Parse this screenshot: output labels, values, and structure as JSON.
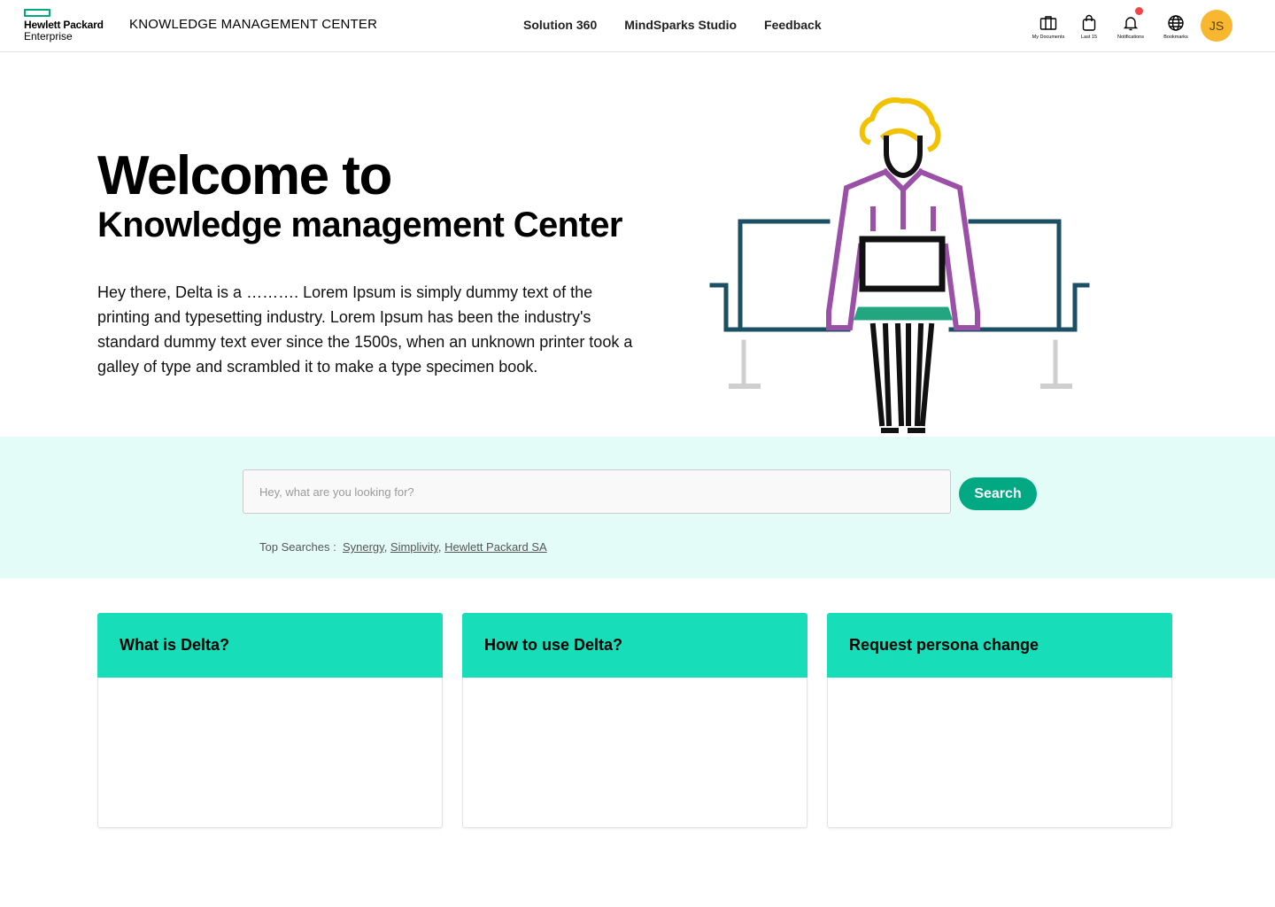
{
  "header": {
    "logo": {
      "line1": "Hewlett Packard",
      "line2": "Enterprise"
    },
    "app_title": "KNOWLEDGE MANAGEMENT CENTER",
    "nav": [
      "Solution 360",
      "MindSparks Studio",
      "Feedback"
    ],
    "tools": {
      "docs": {
        "label": "My Documents",
        "icon": "briefcase-icon"
      },
      "last": {
        "label": "Last 15",
        "icon": "bag-icon"
      },
      "notifications": {
        "label": "Notifications",
        "icon": "bell-icon",
        "has_unread": true
      },
      "bookmarks": {
        "label": "Bookmarks",
        "icon": "globe-icon"
      }
    },
    "avatar_initials": "JS"
  },
  "hero": {
    "title_line1": "Welcome to",
    "title_line2": "Knowledge management Center",
    "description": "Hey there, Delta is a ………. Lorem Ipsum is simply dummy text of the printing and typesetting industry. Lorem Ipsum has been the industry's standard dummy text ever since the 1500s, when an unknown printer took a galley of type and scrambled it to make a type specimen book."
  },
  "search": {
    "placeholder": "Hey, what are you looking for?",
    "value": "",
    "button_label": "Search",
    "top_searches_label": "Top Searches :",
    "top_searches": [
      "Synergy",
      "Simplivity",
      "Hewlett Packard SA"
    ]
  },
  "cards": [
    {
      "title": "What is Delta?"
    },
    {
      "title": "How to use Delta?"
    },
    {
      "title": "Request persona change"
    }
  ],
  "colors": {
    "brand_green": "#01a982",
    "card_header": "#17ddb8",
    "search_band": "#e4fcf8",
    "avatar": "#f7b830",
    "notification_dot": "#f0454a"
  }
}
